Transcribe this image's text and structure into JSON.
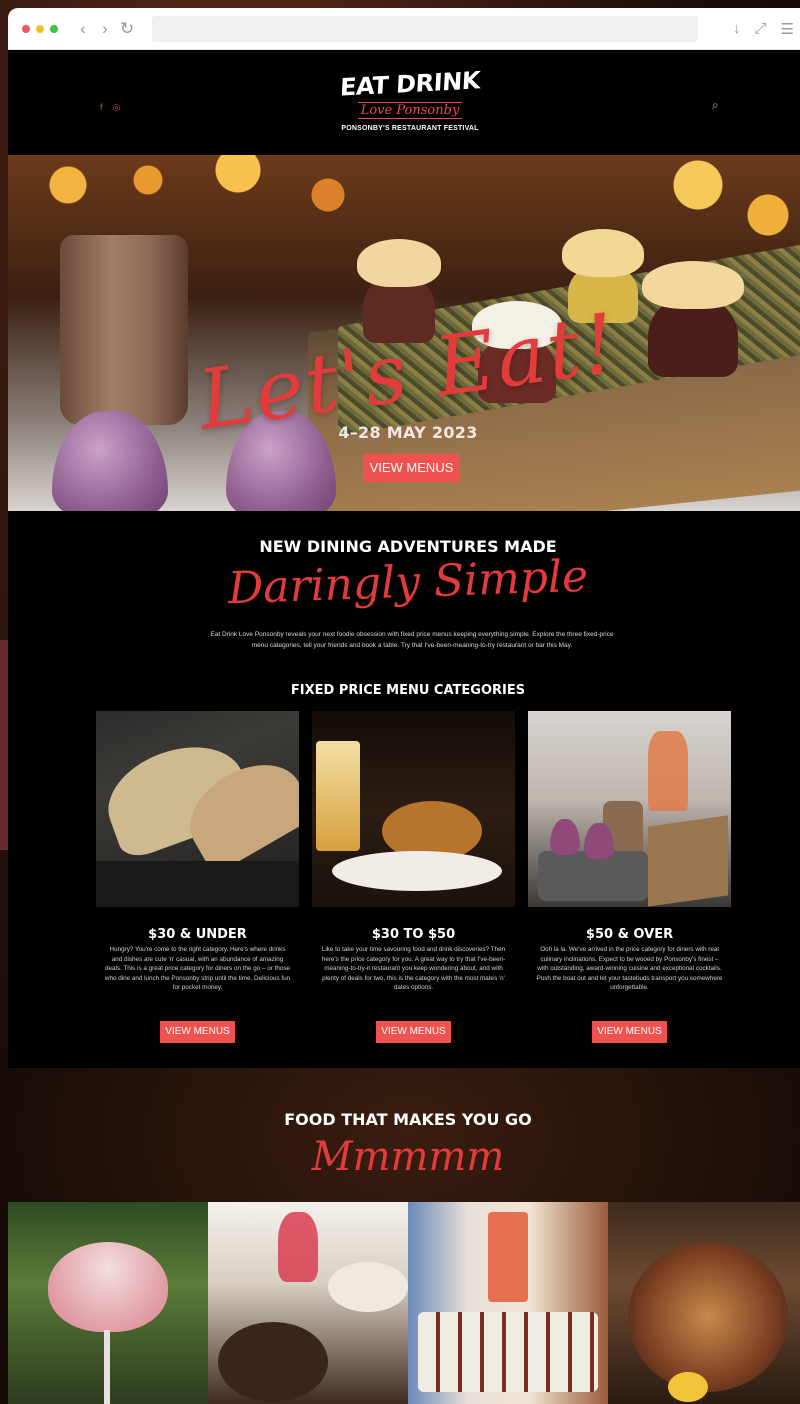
{
  "colors": {
    "accent": "#f0524f",
    "script_red": "#e23b3b",
    "page_bg": "#000000"
  },
  "browser": {
    "icons": [
      "back-icon",
      "forward-icon",
      "reload-icon",
      "download-icon",
      "fullscreen-icon",
      "menu-icon"
    ],
    "back_glyph": "‹",
    "forward_glyph": "›",
    "reload_glyph": "↻",
    "download_glyph": "↓",
    "fullscreen_glyph": "⤢",
    "menu_glyph": "☰"
  },
  "header": {
    "logo_line1": "EAT DRINK",
    "logo_line2": "Love Ponsonby",
    "logo_line3": "PONSONBY'S RESTAURANT FESTIVAL",
    "social_icons": [
      "facebook-icon",
      "instagram-icon"
    ],
    "facebook_glyph": "f",
    "instagram_glyph": "◎",
    "search_glyph": "⌕"
  },
  "hero": {
    "script": "Let's Eat!",
    "dates": "4–28 MAY 2023",
    "button": "VIEW MENUS"
  },
  "intro": {
    "title": "NEW DINING ADVENTURES MADE",
    "script": "Daringly Simple",
    "body": "Eat Drink Love Ponsonby reveals your next foodie obsession with fixed price menus keeping everything simple. Explore the three fixed-price menu categories, tell your friends and book a table. Try that I've-been-meaning-to-try restaurant or bar this May.",
    "subtitle": "FIXED PRICE MENU CATEGORIES"
  },
  "categories": [
    {
      "title": "$30 & UNDER",
      "desc": "Hungry? You're come to the right category. Here's where drinks and dishes are cute 'n' casual, with an abundance of amazing deals. This is a great price category for diners on the go – or those who dine and lunch the Ponsonby strip until the time. Delicious fun for pocket money.",
      "button": "VIEW MENUS"
    },
    {
      "title": "$30 TO $50",
      "desc": "Like to take your time savouring food and drink discoveries? Then here's the price category for you. A great way to try that I've-been-meaning-to-try-it restaurant you keep wondering about, and with plenty of deals for two, this is the category with the most mates 'n' dates options.",
      "button": "VIEW MENUS"
    },
    {
      "title": "$50 & OVER",
      "desc": "Ooh la la. We've arrived in the price category for diners with real culinary inclinations. Expect to be wooed by Ponsonby's finest – with outstanding, award-winning cuisine and exceptional cocktails. Push the boat out and let your tastebuds transport you somewhere unforgettable.",
      "button": "VIEW MENUS"
    }
  ],
  "food": {
    "title": "FOOD THAT MAKES YOU GO",
    "script": "Mmmmm"
  }
}
